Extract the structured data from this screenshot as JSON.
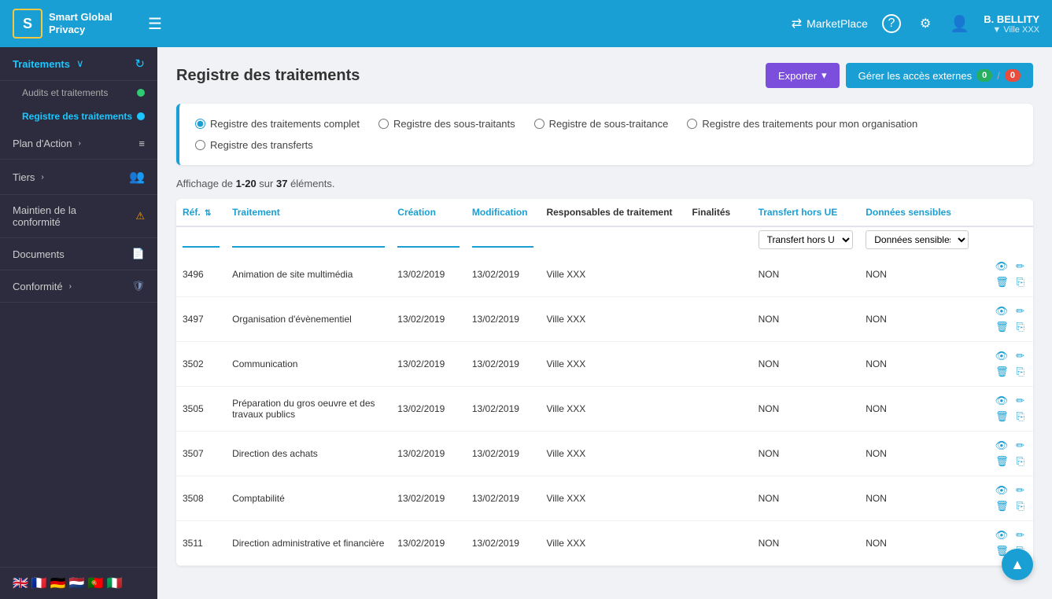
{
  "app": {
    "logo_letter": "S",
    "logo_name": "Smart Global\nPrivacy",
    "hamburger": "☰",
    "marketplace_icon": "⇄",
    "marketplace_label": "MarketPlace",
    "help_icon": "?",
    "settings_icon": "⚙",
    "user_icon": "👤",
    "user_name": "B. BELLITY",
    "user_org": "▼ Ville XXX"
  },
  "sidebar": {
    "items": [
      {
        "id": "traitements",
        "label": "Traitements",
        "icon": "↻",
        "arrow": "∨",
        "active": true
      },
      {
        "id": "audits",
        "label": "Audits et traitements",
        "dot": "green"
      },
      {
        "id": "registre",
        "label": "Registre des traitements",
        "dot": "blue",
        "active": true
      },
      {
        "id": "plan",
        "label": "Plan d'Action",
        "icon": "≡",
        "arrow": ">"
      },
      {
        "id": "tiers",
        "label": "Tiers",
        "icon": "👥",
        "arrow": ">"
      },
      {
        "id": "maintien",
        "label": "Maintien de la conformité",
        "icon": "⚠"
      },
      {
        "id": "documents",
        "label": "Documents",
        "icon": "📄"
      },
      {
        "id": "conformite",
        "label": "Conformité",
        "icon": "🛡",
        "arrow": ">"
      }
    ],
    "flags": [
      "🇬🇧",
      "🇫🇷",
      "🇩🇪",
      "🇳🇱",
      "🇵🇹",
      "🇮🇹"
    ]
  },
  "page": {
    "title": "Registre des traitements",
    "export_label": "Exporter",
    "manage_label": "Gérer les accès externes",
    "badge_green": "0",
    "badge_sep": "/",
    "badge_red": "0"
  },
  "filters": {
    "options": [
      {
        "id": "complet",
        "label": "Registre des traitements complet",
        "checked": true
      },
      {
        "id": "sous-traitants",
        "label": "Registre des sous-traitants",
        "checked": false
      },
      {
        "id": "sous-traitance",
        "label": "Registre de sous-traitance",
        "checked": false
      },
      {
        "id": "organisation",
        "label": "Registre des traitements pour mon organisation",
        "checked": false
      },
      {
        "id": "transferts",
        "label": "Registre des transferts",
        "checked": false
      }
    ]
  },
  "affichage": {
    "text": "Affichage de ",
    "range": "1-20",
    "sur": " sur ",
    "total": "37",
    "elements": " éléments."
  },
  "table": {
    "headers": [
      {
        "id": "ref",
        "label": "Réf.",
        "color": "blue",
        "sortable": true
      },
      {
        "id": "traitement",
        "label": "Traitement",
        "color": "blue"
      },
      {
        "id": "creation",
        "label": "Création",
        "color": "blue"
      },
      {
        "id": "modification",
        "label": "Modification",
        "color": "blue"
      },
      {
        "id": "responsables",
        "label": "Responsables de traitement",
        "color": "dark"
      },
      {
        "id": "finalites",
        "label": "Finalités",
        "color": "dark"
      },
      {
        "id": "transfert",
        "label": "Transfert hors UE",
        "color": "blue"
      },
      {
        "id": "donnees",
        "label": "Données sensibles",
        "color": "blue"
      },
      {
        "id": "actions",
        "label": "",
        "color": "dark"
      }
    ],
    "filter_transfert_placeholder": "Transfert hors UE",
    "filter_donnees_placeholder": "Données sensibles",
    "rows": [
      {
        "ref": "3496",
        "traitement": "Animation de site multimédia",
        "creation": "13/02/2019",
        "modification": "13/02/2019",
        "responsable": "Ville XXX",
        "finalites": "",
        "transfert": "NON",
        "donnees": "NON"
      },
      {
        "ref": "3497",
        "traitement": "Organisation d'évènementiel",
        "creation": "13/02/2019",
        "modification": "13/02/2019",
        "responsable": "Ville XXX",
        "finalites": "",
        "transfert": "NON",
        "donnees": "NON"
      },
      {
        "ref": "3502",
        "traitement": "Communication",
        "creation": "13/02/2019",
        "modification": "13/02/2019",
        "responsable": "Ville XXX",
        "finalites": "",
        "transfert": "NON",
        "donnees": "NON"
      },
      {
        "ref": "3505",
        "traitement": "Préparation du gros oeuvre et des travaux publics",
        "creation": "13/02/2019",
        "modification": "13/02/2019",
        "responsable": "Ville XXX",
        "finalites": "",
        "transfert": "NON",
        "donnees": "NON"
      },
      {
        "ref": "3507",
        "traitement": "Direction des achats",
        "creation": "13/02/2019",
        "modification": "13/02/2019",
        "responsable": "Ville XXX",
        "finalites": "",
        "transfert": "NON",
        "donnees": "NON"
      },
      {
        "ref": "3508",
        "traitement": "Comptabilité",
        "creation": "13/02/2019",
        "modification": "13/02/2019",
        "responsable": "Ville XXX",
        "finalites": "",
        "transfert": "NON",
        "donnees": "NON"
      },
      {
        "ref": "3511",
        "traitement": "Direction administrative et financière",
        "creation": "13/02/2019",
        "modification": "13/02/2019",
        "responsable": "Ville XXX",
        "finalites": "",
        "transfert": "NON",
        "donnees": "NON"
      }
    ],
    "actions": {
      "view": "👁",
      "edit": "✏",
      "delete": "🗑",
      "copy": "⎘"
    }
  }
}
